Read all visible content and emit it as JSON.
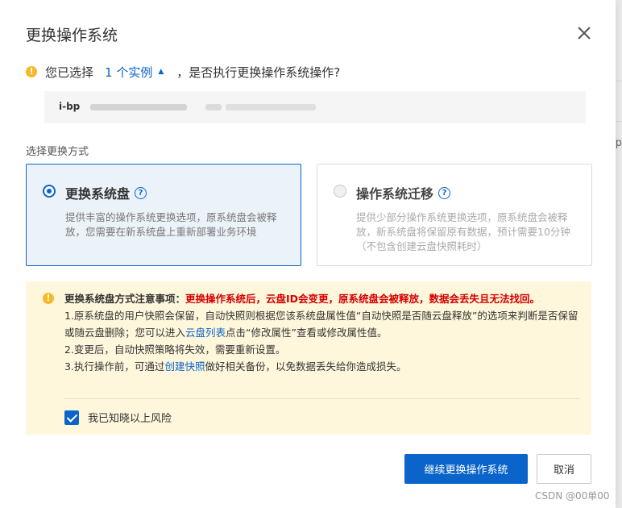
{
  "dialog": {
    "title": "更换操作系统",
    "close_icon": "close-icon"
  },
  "selection": {
    "prefix": "您已选择",
    "count_link": "1 个实例",
    "suffix": "，是否执行更换操作系统操作?",
    "instance_id": "i-bp"
  },
  "mode": {
    "label": "选择更换方式",
    "options": [
      {
        "title": "更换系统盘",
        "desc": "提供丰富的操作系统更换选项，原系统盘会被释放，您需要在新系统盘上重新部署业务环境",
        "selected": true
      },
      {
        "title": "操作系统迁移",
        "desc": "提供少部分操作系统更换选项，原系统盘会被释放，新系统盘将保留原有数据，预计需要10分钟（不包含创建云盘快照耗时）",
        "selected": false
      }
    ]
  },
  "notice": {
    "heading": "更换系统盘方式注意事项：",
    "warning": "更换操作系统后，云盘ID会变更，原系统盘会被释放，数据会丢失且无法找回。",
    "item1_a": "1.原系统盘的用户快照会保留，自动快照则根据您该系统盘属性值“自动快照是否随云盘释放”的选项来判断是否保留或随云盘删除；您可以进入",
    "item1_link": "云盘列表",
    "item1_b": "点击“修改属性”查看或修改属性值。",
    "item2": "2.变更后，自动快照策略将失效，需要重新设置。",
    "item3_a": "3.执行操作前，可通过",
    "item3_link": "创建快照",
    "item3_b": "做好相关备份，以免数据丢失给你造成损失。",
    "agree_label": "我已知晓以上风险",
    "agree_checked": true
  },
  "buttons": {
    "confirm": "继续更换操作系统",
    "cancel": "取消"
  },
  "background": {
    "right_text": "p"
  },
  "watermark": "CSDN @00单00",
  "colors": {
    "primary": "#0a64c9",
    "warning_icon": "#f5b92c",
    "notice_bg": "#fff7dc",
    "danger": "#d40000",
    "selected_card_bg": "#ecf2f9"
  }
}
